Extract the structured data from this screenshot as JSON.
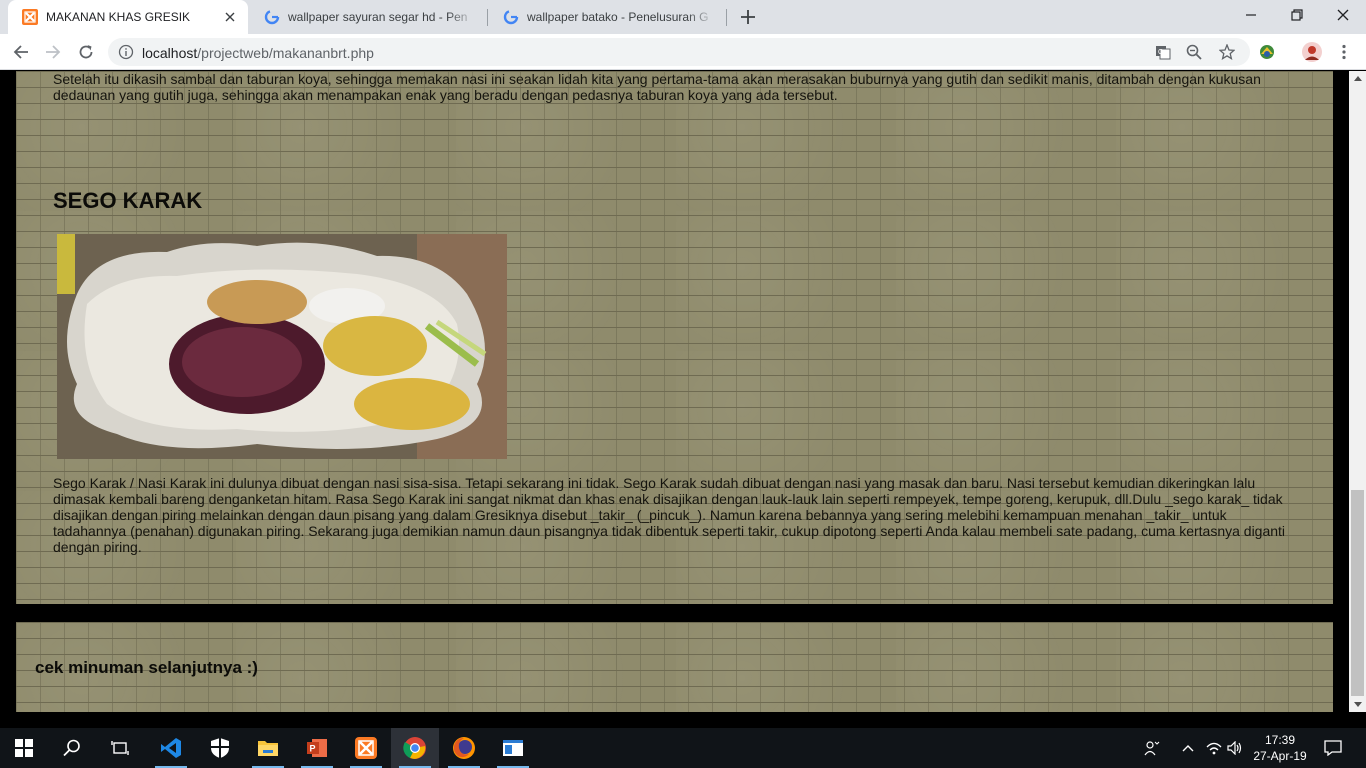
{
  "browser": {
    "tabs": [
      {
        "title": "MAKANAN KHAS GRESIK",
        "active": true,
        "favicon": "xampp-icon"
      },
      {
        "title": "wallpaper sayuran segar hd - Pen",
        "active": false,
        "favicon": "google-icon"
      },
      {
        "title": "wallpaper batako - Penelusuran G",
        "active": false,
        "favicon": "google-icon"
      }
    ],
    "url_host": "localhost",
    "url_path": "/projectweb/makananbrt.php"
  },
  "page": {
    "intro_paragraph": "Setelah itu dikasih sambal dan taburan koya, sehingga memakan nasi ini seakan lidah kita yang pertama-tama akan merasakan buburnya yang gutih dan sedikit manis, ditambah dengan kukusan dedaunan yang gutih juga, sehingga akan menampakan enak yang beradu dengan pedasnya taburan koya yang ada tersebut.",
    "section_title": "SEGO KARAK",
    "section_paragraph": "Sego Karak / Nasi Karak ini dulunya dibuat dengan nasi sisa-sisa. Tetapi sekarang ini tidak. Sego Karak sudah dibuat dengan nasi yang masak dan baru. Nasi tersebut kemudian dikeringkan lalu dimasak kembali bareng denganketan hitam. Rasa Sego Karak ini sangat nikmat dan khas enak disajikan dengan lauk-lauk lain seperti rempeyek, tempe goreng, kerupuk, dll.Dulu _sego karak_ tidak disajikan dengan piring melainkan dengan daun pisang yang dalam Gresiknya disebut _takir_ (_pincuk_). Namun karena bebannya yang sering melebihi kemampuan menahan _takir_ untuk tadahannya (penahan) digunakan piring. Sekarang juga demikian namun daun pisangnya tidak dibentuk seperti takir, cukup dipotong seperti Anda kalau membeli sate padang, cuma kertasnya diganti dengan piring.",
    "footer_link": "cek minuman selanjutnya :)",
    "background_color": "#8f8b6c"
  },
  "taskbar": {
    "apps": [
      "start-icon",
      "search-icon",
      "task-view-icon",
      "vscode-icon",
      "security-icon",
      "file-explorer-icon",
      "powerpoint-icon",
      "xampp-icon",
      "chrome-icon",
      "firefox-icon",
      "app-window-icon"
    ],
    "time": "17:39",
    "date": "27-Apr-19"
  }
}
